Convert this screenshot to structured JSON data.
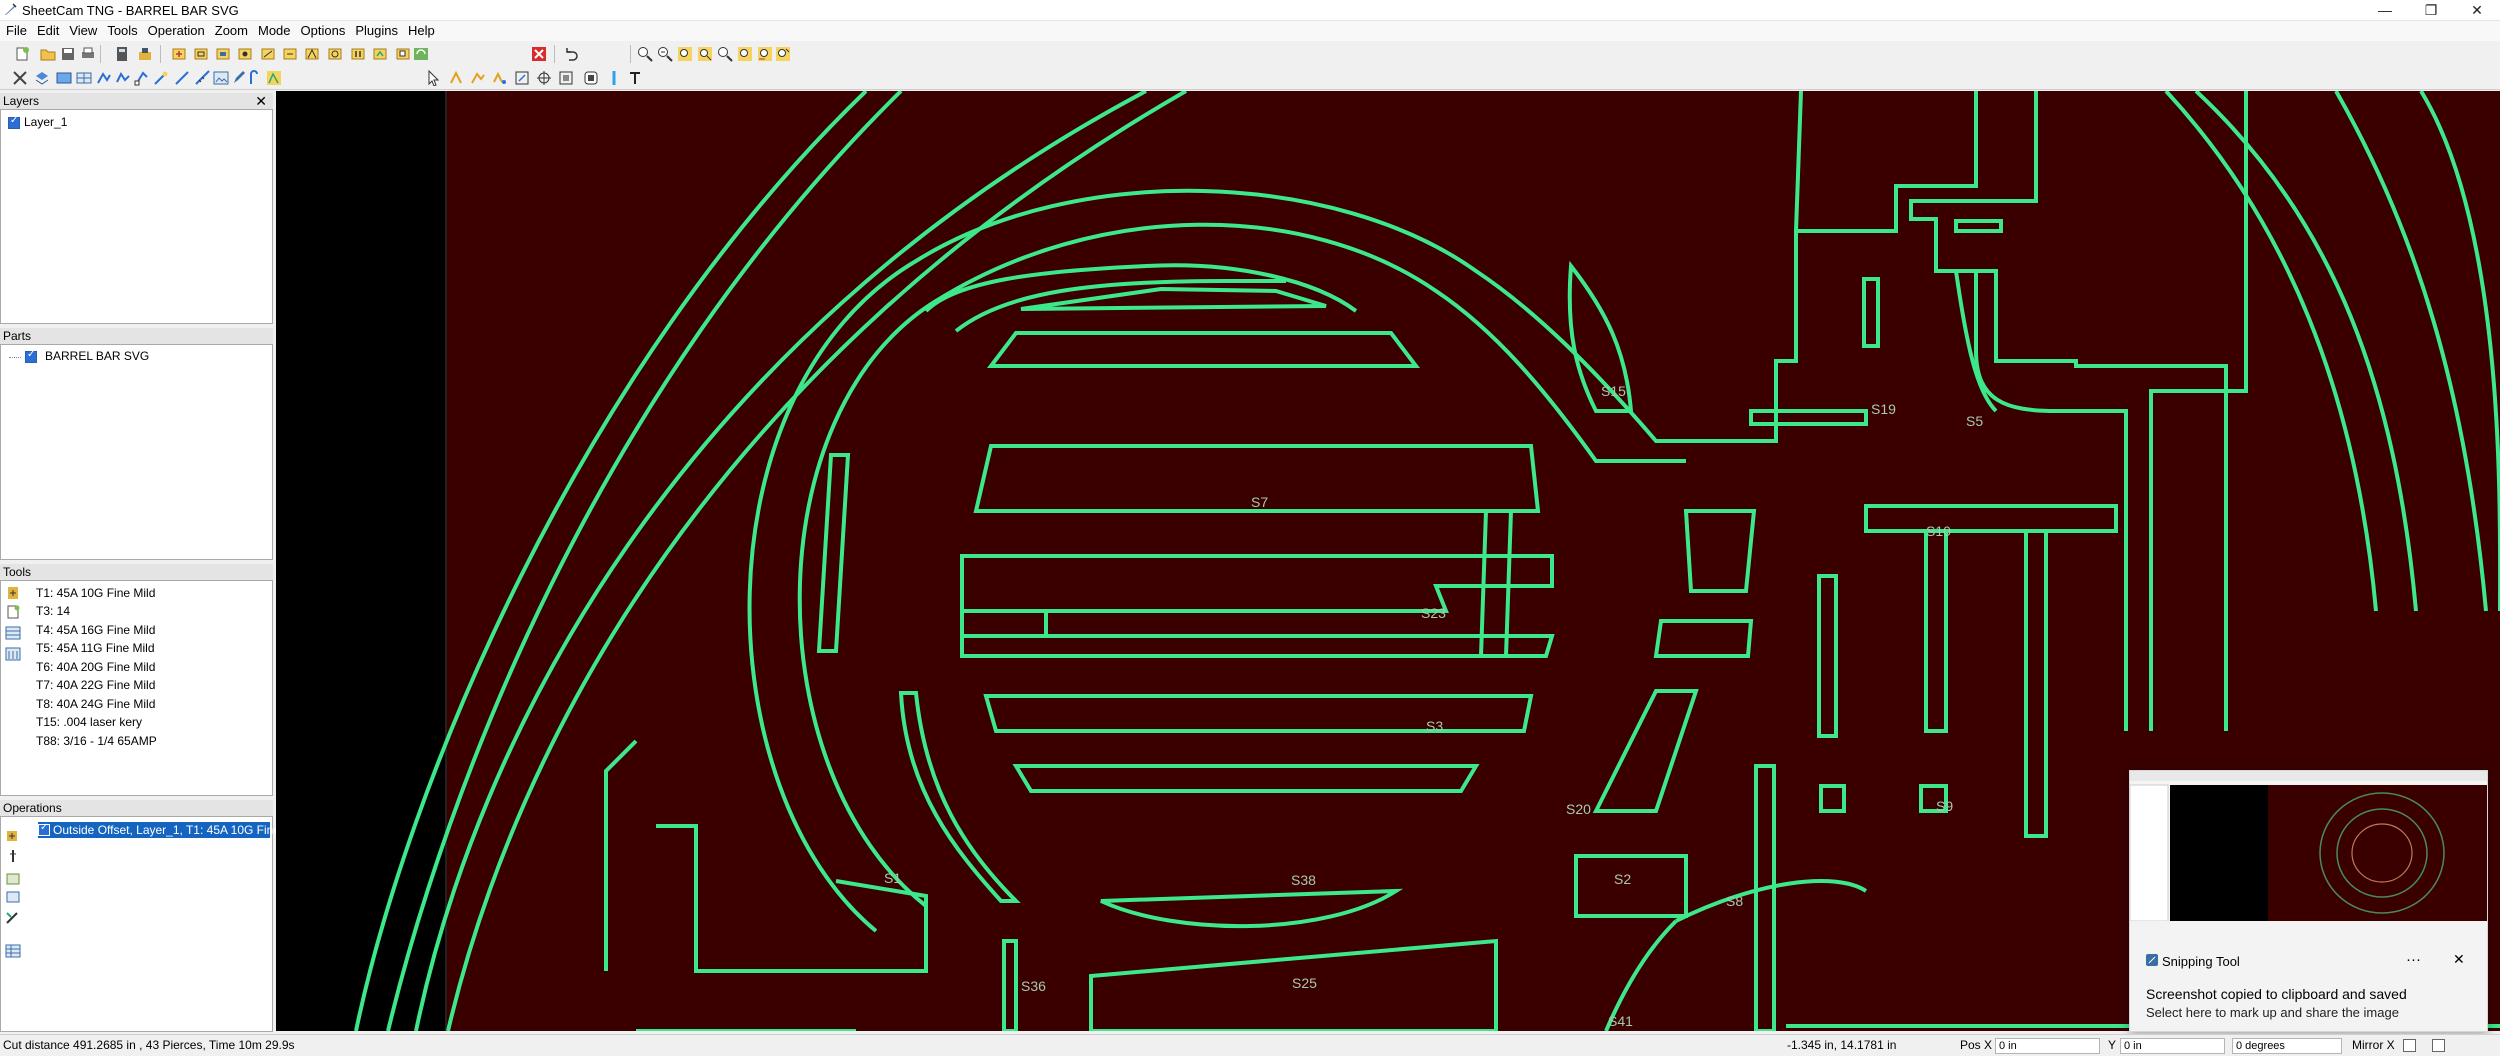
{
  "window": {
    "title": "SheetCam TNG - BARREL BAR SVG"
  },
  "menu": [
    "File",
    "Edit",
    "View",
    "Tools",
    "Operation",
    "Zoom",
    "Mode",
    "Options",
    "Plugins",
    "Help"
  ],
  "panels": {
    "layers": {
      "title": "Layers",
      "items": [
        "Layer_1"
      ]
    },
    "parts": {
      "title": "Parts",
      "items": [
        "BARREL BAR SVG"
      ]
    },
    "tools": {
      "title": "Tools",
      "items": [
        "T1: 45A 10G Fine Mild",
        "T3: 14",
        "T4: 45A 16G Fine Mild",
        "T5: 45A 11G Fine Mild",
        "T6: 40A 20G Fine Mild",
        "T7: 40A 22G Fine Mild",
        "T8: 40A 24G Fine Mild",
        "T15: .004 laser kery",
        "T88: 3/16 - 1/4 65AMP"
      ]
    },
    "operations": {
      "title": "Operations",
      "items": [
        "Outside Offset, Layer_1, T1: 45A 10G Fine..."
      ]
    }
  },
  "canvas": {
    "labels": [
      "S15",
      "S19",
      "S5",
      "S7",
      "S23",
      "S3",
      "S10",
      "S38",
      "S36",
      "S25",
      "S41",
      "S2",
      "S9",
      "S1",
      "S20",
      "S8"
    ]
  },
  "status": {
    "cut_info": "Cut distance 491.2685 in , 43 Pierces, Time 10m 29.9s",
    "coords": "-1.345 in, 14.1781 in",
    "pos_x_label": "Pos X",
    "pos_x_value": "0 in",
    "y_label": "Y",
    "y_value": "0 in",
    "angle_value": "0 degrees",
    "mirror_label": "Mirror X"
  },
  "toast": {
    "app": "Snipping Tool",
    "message": "Screenshot copied to clipboard and saved",
    "sub": "Select here to mark up and share the image",
    "more": "···",
    "close": "✕"
  },
  "colors": {
    "canvas_bg": "#3a0000",
    "path": "#3de88a",
    "selection": "#1565c0"
  }
}
